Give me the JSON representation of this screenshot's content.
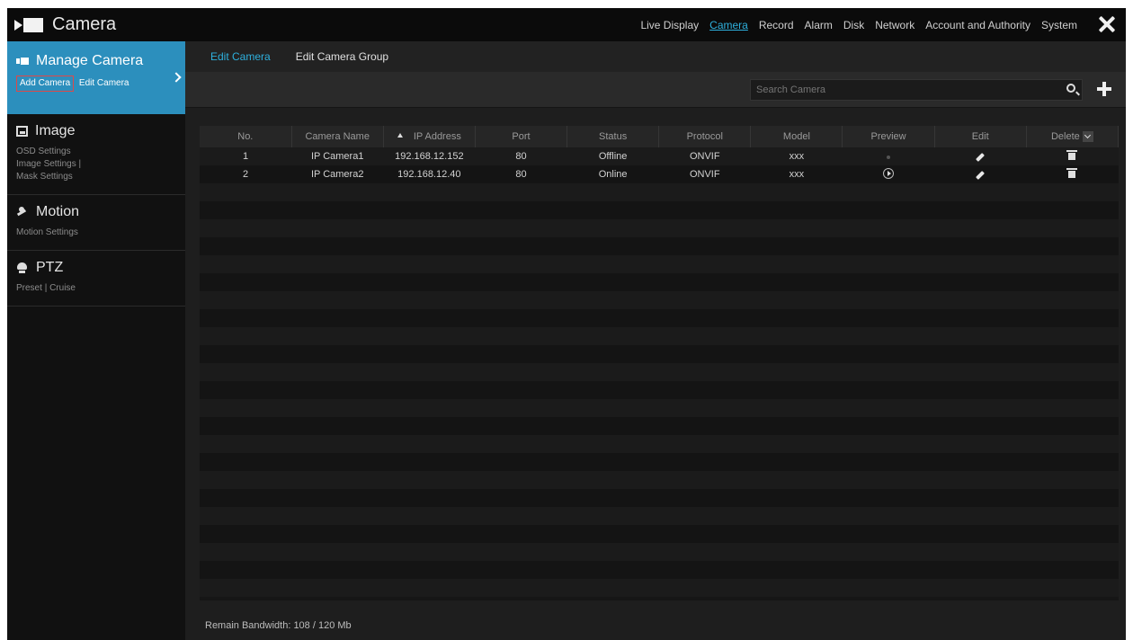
{
  "app": {
    "title": "Camera"
  },
  "topnav": [
    {
      "label": "Live Display",
      "active": false
    },
    {
      "label": "Camera",
      "active": true
    },
    {
      "label": "Record",
      "active": false
    },
    {
      "label": "Alarm",
      "active": false
    },
    {
      "label": "Disk",
      "active": false
    },
    {
      "label": "Network",
      "active": false
    },
    {
      "label": "Account and Authority",
      "active": false
    },
    {
      "label": "System",
      "active": false
    }
  ],
  "sidebar": {
    "manage": {
      "title": "Manage Camera",
      "add": "Add Camera",
      "edit": "Edit Camera"
    },
    "image": {
      "title": "Image",
      "osd": "OSD Settings",
      "image_settings": "Image Settings",
      "sep": "|",
      "mask": "Mask Settings"
    },
    "motion": {
      "title": "Motion",
      "settings": "Motion Settings"
    },
    "ptz": {
      "title": "PTZ",
      "preset": "Preset",
      "sep": "|",
      "cruise": "Cruise"
    }
  },
  "tabs": {
    "edit_camera": "Edit Camera",
    "edit_group": "Edit Camera Group"
  },
  "search": {
    "placeholder": "Search Camera"
  },
  "table": {
    "headers": {
      "no": "No.",
      "name": "Camera Name",
      "ip": "IP Address",
      "port": "Port",
      "status": "Status",
      "protocol": "Protocol",
      "model": "Model",
      "preview": "Preview",
      "edit": "Edit",
      "delete": "Delete"
    },
    "rows": [
      {
        "no": "1",
        "name": "IP Camera1",
        "ip": "192.168.12.152",
        "port": "80",
        "status": "Offline",
        "protocol": "ONVIF",
        "model": "xxx"
      },
      {
        "no": "2",
        "name": "IP Camera2",
        "ip": "192.168.12.40",
        "port": "80",
        "status": "Online",
        "protocol": "ONVIF",
        "model": "xxx"
      }
    ]
  },
  "footer": {
    "bandwidth": "Remain Bandwidth: 108 / 120 Mb"
  },
  "colors": {
    "accent": "#2eb0dd",
    "sidebar_active": "#2c8fbd",
    "selected_outline": "#e04848"
  }
}
